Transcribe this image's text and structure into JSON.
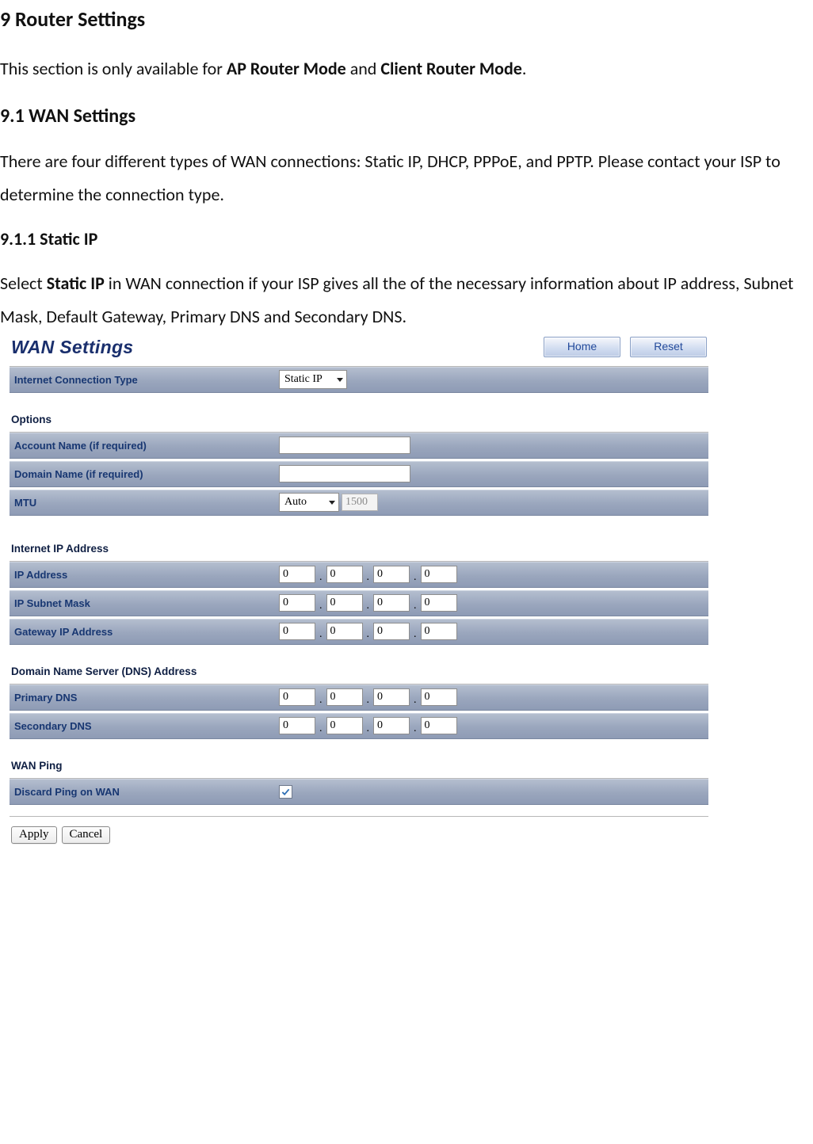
{
  "doc": {
    "h1": "9 Router Settings",
    "p1_a": "This section is only available for ",
    "p1_b": "AP Router Mode",
    "p1_c": " and ",
    "p1_d": "Client Router Mode",
    "p1_e": ".",
    "h2": "9.1 WAN Settings",
    "p2": "There are four different types of WAN connections: Static IP, DHCP, PPPoE, and PPTP. Please contact your ISP to determine the connection type.",
    "h3": "9.1.1 Static IP",
    "p3_a": "Select ",
    "p3_b": "Static IP",
    "p3_c": " in WAN connection if your ISP gives all the of the necessary information about IP address, Subnet Mask, Default Gateway, Primary DNS and Secondary DNS."
  },
  "ui": {
    "title": "WAN Settings",
    "home": "Home",
    "reset": "Reset",
    "conn_type_label": "Internet Connection Type",
    "conn_type_value": "Static IP",
    "options_head": "Options",
    "account_label": "Account Name (if required)",
    "account_value": "",
    "domain_label": "Domain Name (if required)",
    "domain_value": "",
    "mtu_label": "MTU",
    "mtu_mode": "Auto",
    "mtu_value": "1500",
    "iip_head": "Internet IP Address",
    "ip_label": "IP Address",
    "mask_label": "IP Subnet Mask",
    "gw_label": "Gateway IP Address",
    "dns_head": "Domain Name Server (DNS) Address",
    "pdns_label": "Primary DNS",
    "sdns_label": "Secondary DNS",
    "ping_head": "WAN Ping",
    "ping_label": "Discard Ping on WAN",
    "ip": [
      "0",
      "0",
      "0",
      "0"
    ],
    "mask": [
      "0",
      "0",
      "0",
      "0"
    ],
    "gw": [
      "0",
      "0",
      "0",
      "0"
    ],
    "pdns": [
      "0",
      "0",
      "0",
      "0"
    ],
    "sdns": [
      "0",
      "0",
      "0",
      "0"
    ],
    "apply": "Apply",
    "cancel": "Cancel",
    "dot": "."
  }
}
